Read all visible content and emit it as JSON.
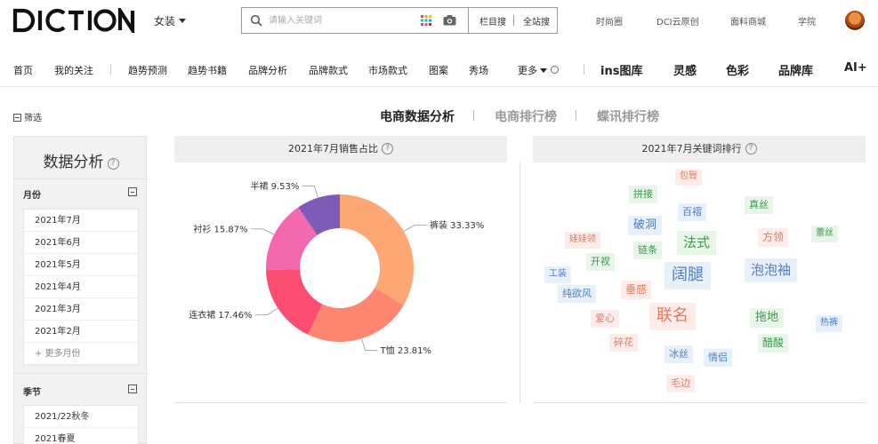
{
  "header": {
    "logo_text": "DICTION",
    "category": "女装",
    "search": {
      "placeholder": "请输入关键词",
      "scope_current": "栏目搜",
      "scope_all": "全站搜"
    },
    "links": [
      "时尚圈",
      "DCI云原创",
      "面料商城",
      "学院"
    ]
  },
  "nav": {
    "items": [
      "首页",
      "我的关注",
      "趋势预测",
      "趋势书籍",
      "品牌分析",
      "品牌款式",
      "市场款式",
      "图案",
      "秀场",
      "更多"
    ],
    "brand_items": [
      "ins图库",
      "灵感",
      "色彩",
      "品牌库",
      "AI+"
    ]
  },
  "filter": {
    "label": "筛选"
  },
  "tabs": [
    {
      "label": "电商数据分析",
      "active": true
    },
    {
      "label": "电商排行榜",
      "active": false
    },
    {
      "label": "蝶讯排行榜",
      "active": false
    }
  ],
  "sidebar": {
    "title": "数据分析",
    "help_glyph": "?",
    "month_section": {
      "label": "月份",
      "items": [
        "2021年7月",
        "2021年6月",
        "2021年5月",
        "2021年4月",
        "2021年3月",
        "2021年2月"
      ],
      "more": "+ 更多月份"
    },
    "season_section": {
      "label": "季节",
      "items": [
        "2021/22秋冬",
        "2021春夏"
      ]
    }
  },
  "sales_panel": {
    "title": "2021年7月销售占比",
    "help_glyph": "?"
  },
  "keyword_panel": {
    "title": "2021年7月关键词排行",
    "help_glyph": "?",
    "words": [
      {
        "text": "包臀",
        "color": "#e07b5f",
        "bg": "#fdecea",
        "size": 10
      },
      {
        "text": "拼接",
        "color": "#3a9a4a",
        "bg": "#e8f5e9",
        "size": 11
      },
      {
        "text": "百褶",
        "color": "#4a7fc1",
        "bg": "#e8f0fb",
        "size": 11
      },
      {
        "text": "真丝",
        "color": "#3a9a4a",
        "bg": "#e8f5e9",
        "size": 11
      },
      {
        "text": "破洞",
        "color": "#4a7fc1",
        "bg": "#e8f0fb",
        "size": 13
      },
      {
        "text": "娃娃领",
        "color": "#e07b5f",
        "bg": "#fdecea",
        "size": 10
      },
      {
        "text": "法式",
        "color": "#3a9a4a",
        "bg": "#e8f5e9",
        "size": 15
      },
      {
        "text": "方领",
        "color": "#e07b5f",
        "bg": "#fdecea",
        "size": 12
      },
      {
        "text": "蕾丝",
        "color": "#3a9a4a",
        "bg": "#e8f5e9",
        "size": 10
      },
      {
        "text": "链条",
        "color": "#3a9a4a",
        "bg": "#e8f5e9",
        "size": 11
      },
      {
        "text": "开衩",
        "color": "#3a9a4a",
        "bg": "#e8f5e9",
        "size": 11
      },
      {
        "text": "工装",
        "color": "#4a7fc1",
        "bg": "#e8f0fb",
        "size": 10
      },
      {
        "text": "阔腿",
        "color": "#4a7fc1",
        "bg": "#e8f0fb",
        "size": 18
      },
      {
        "text": "泡泡袖",
        "color": "#4a7fc1",
        "bg": "#e8f0fb",
        "size": 15
      },
      {
        "text": "纯欲风",
        "color": "#4a7fc1",
        "bg": "#e8f0fb",
        "size": 11
      },
      {
        "text": "垂感",
        "color": "#e07b5f",
        "bg": "#fdecea",
        "size": 12
      },
      {
        "text": "爱心",
        "color": "#e07b5f",
        "bg": "#fdecea",
        "size": 11
      },
      {
        "text": "联名",
        "color": "#e07b5f",
        "bg": "#fdecea",
        "size": 18
      },
      {
        "text": "拖地",
        "color": "#3a9a4a",
        "bg": "#e8f5e9",
        "size": 13
      },
      {
        "text": "热裤",
        "color": "#4a7fc1",
        "bg": "#e8f0fb",
        "size": 10
      },
      {
        "text": "碎花",
        "color": "#e07b5f",
        "bg": "#fdecea",
        "size": 11
      },
      {
        "text": "醋酸",
        "color": "#3a9a4a",
        "bg": "#e8f5e9",
        "size": 12
      },
      {
        "text": "冰丝",
        "color": "#4a7fc1",
        "bg": "#e8f0fb",
        "size": 11
      },
      {
        "text": "情侣",
        "color": "#4a7fc1",
        "bg": "#e8f0fb",
        "size": 11
      },
      {
        "text": "毛边",
        "color": "#e07b5f",
        "bg": "#fdecea",
        "size": 11
      }
    ]
  },
  "chart_data": {
    "type": "pie",
    "subtype": "donut",
    "title": "2021年7月销售占比",
    "slices": [
      {
        "label": "裤装",
        "value": 33.33,
        "display": "33.33%",
        "color": "#fda874"
      },
      {
        "label": "T恤",
        "value": 23.81,
        "display": "23.81%",
        "color": "#fd8670"
      },
      {
        "label": "连衣裙",
        "value": 17.46,
        "display": "17.46%",
        "color": "#fa4d6f"
      },
      {
        "label": "衬衫",
        "value": 15.87,
        "display": "15.87%",
        "color": "#f468b0"
      },
      {
        "label": "半裙",
        "value": 9.53,
        "display": "9.53%",
        "color": "#7e5bb6"
      }
    ],
    "start_angle_deg": 0,
    "direction": "clockwise"
  }
}
